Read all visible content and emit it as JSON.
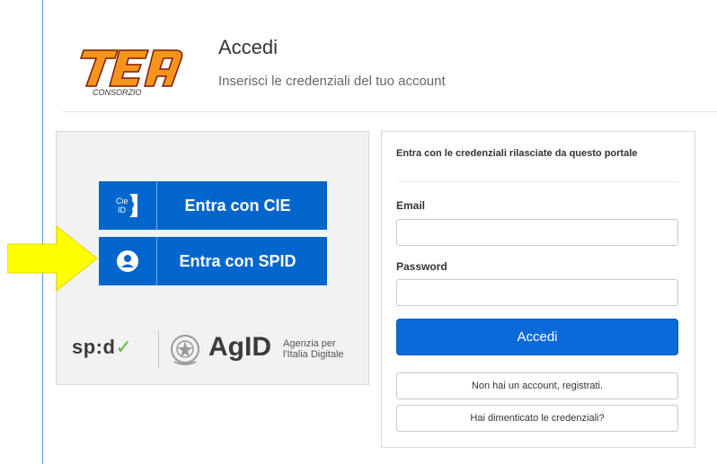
{
  "header": {
    "logo_text": "TEA",
    "logo_subtext": "CONSORZIO",
    "title": "Accedi",
    "subtitle": "Inserisci le credenziali del tuo account"
  },
  "identity_providers": {
    "cie": {
      "label": "Entra con CIE",
      "icon": "cie-id-icon",
      "icon_text": "Cie ID"
    },
    "spid": {
      "label": "Entra con SPID",
      "icon": "user-circle-icon"
    },
    "button_color": "#0066cc"
  },
  "footer_logos": {
    "spid": "sp:d",
    "spid_check": "✓",
    "agid": "AgID",
    "agid_sub_line1": "Agenzia per",
    "agid_sub_line2": "l'Italia Digitale"
  },
  "login_form": {
    "intro": "Entra con le credenziali rilasciate da questo portale",
    "email_label": "Email",
    "email_value": "",
    "password_label": "Password",
    "password_value": "",
    "submit_label": "Accedi",
    "register_label": "Non hai un account, registrati.",
    "forgot_label": "Hai dimenticato le credenziali?",
    "accent_color": "#0b6ad9"
  },
  "annotation": {
    "arrow_color": "#ffff00"
  }
}
